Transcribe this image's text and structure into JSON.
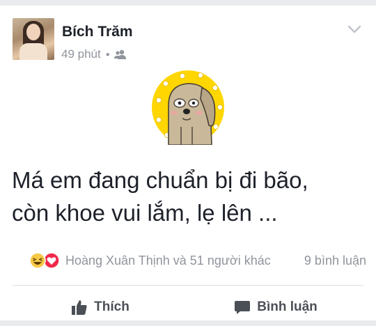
{
  "post": {
    "author_name": "Bích Trăm",
    "time": "49 phút",
    "audience_icon": "friends-icon",
    "menu_icon": "chevron-down-icon",
    "sticker": "dog-sticker",
    "text_lines": [
      "Má em đang chuẩn bị đi bão,",
      "còn khoe vui lắm, lẹ lên ..."
    ]
  },
  "reactions": {
    "icons": [
      "haha-icon",
      "love-icon"
    ],
    "names_text": "Hoàng Xuân Thịnh và 51 người khác",
    "comments_text": "9 bình luận"
  },
  "actions": {
    "like_label": "Thích",
    "comment_label": "Bình luận"
  },
  "colors": {
    "background": "#e9ebee",
    "text": "#1d2129",
    "secondary_text": "#90949c",
    "action_text": "#4b4f56",
    "sticker_yellow": "#ffd600",
    "love_red": "#f0284a"
  }
}
